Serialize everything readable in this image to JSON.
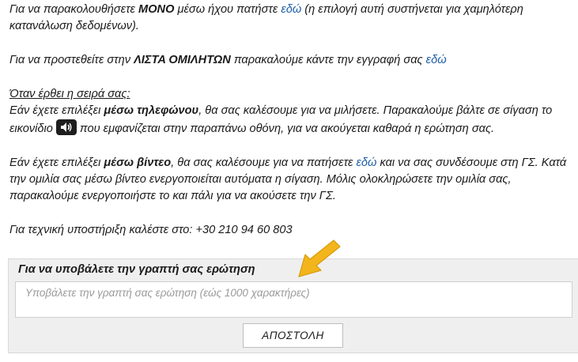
{
  "paragraphs": {
    "p1": {
      "pre": "Για να παρακολουθήσετε ",
      "bold": "ΜΟΝΟ",
      "mid": " μέσω ήχου πατήστε ",
      "link": "εδώ",
      "post": " (η επιλογή αυτή συστήνεται για χαμηλότερη κατανάλωση δεδομένων)."
    },
    "p2": {
      "pre": "Για να προστεθείτε στην ",
      "bold": "ΛΙΣΤΑ ΟΜΙΛΗΤΩΝ",
      "mid": " παρακαλούμε κάντε την εγγραφή σας ",
      "link": "εδώ"
    },
    "p3": {
      "heading": "Όταν έρθει η σειρά σας:",
      "pre": "Εάν έχετε επιλέξει ",
      "bold": "μέσω τηλεφώνου",
      "mid": ", θα σας καλέσουμε για να μιλήσετε. Παρακαλούμε βάλτε σε σίγαση το εικονίδιο",
      "post": "που εμφανίζεται στην παραπάνω οθόνη, για να ακούγεται καθαρά η ερώτηση σας."
    },
    "p4": {
      "pre": "Εάν έχετε επιλέξει ",
      "bold": "μέσω βίντεο",
      "mid": ", θα σας καλέσουμε για να πατήσετε ",
      "link": "εδώ",
      "post": " και να σας συνδέσουμε στη ΓΣ. Κατά την ομιλία σας μέσω βίντεο ενεργοποιείται αυτόματα η σίγαση. Μόλις ολοκληρώσετε την ομιλία σας, παρακαλούμε ενεργοποιήστε το και πάλι για να ακούσετε την ΓΣ."
    },
    "p5": {
      "text": "Για τεχνική υποστήριξη καλέστε στο: +30 210 94 60 803"
    }
  },
  "question_panel": {
    "title": "Για να υποβάλετε την γραπτή σας ερώτηση",
    "placeholder": "Υποβάλετε την γραπτή σας ερώτηση (εώς 1000 χαρακτήρες)",
    "submit_label": "ΑΠΟΣΤΟΛΗ"
  },
  "colors": {
    "link": "#1f5fa8",
    "arrow": "#f2b61c",
    "panel_bg": "#efefef"
  },
  "icons": {
    "speaker": "speaker-icon",
    "pointer": "arrow-pointer-icon"
  }
}
